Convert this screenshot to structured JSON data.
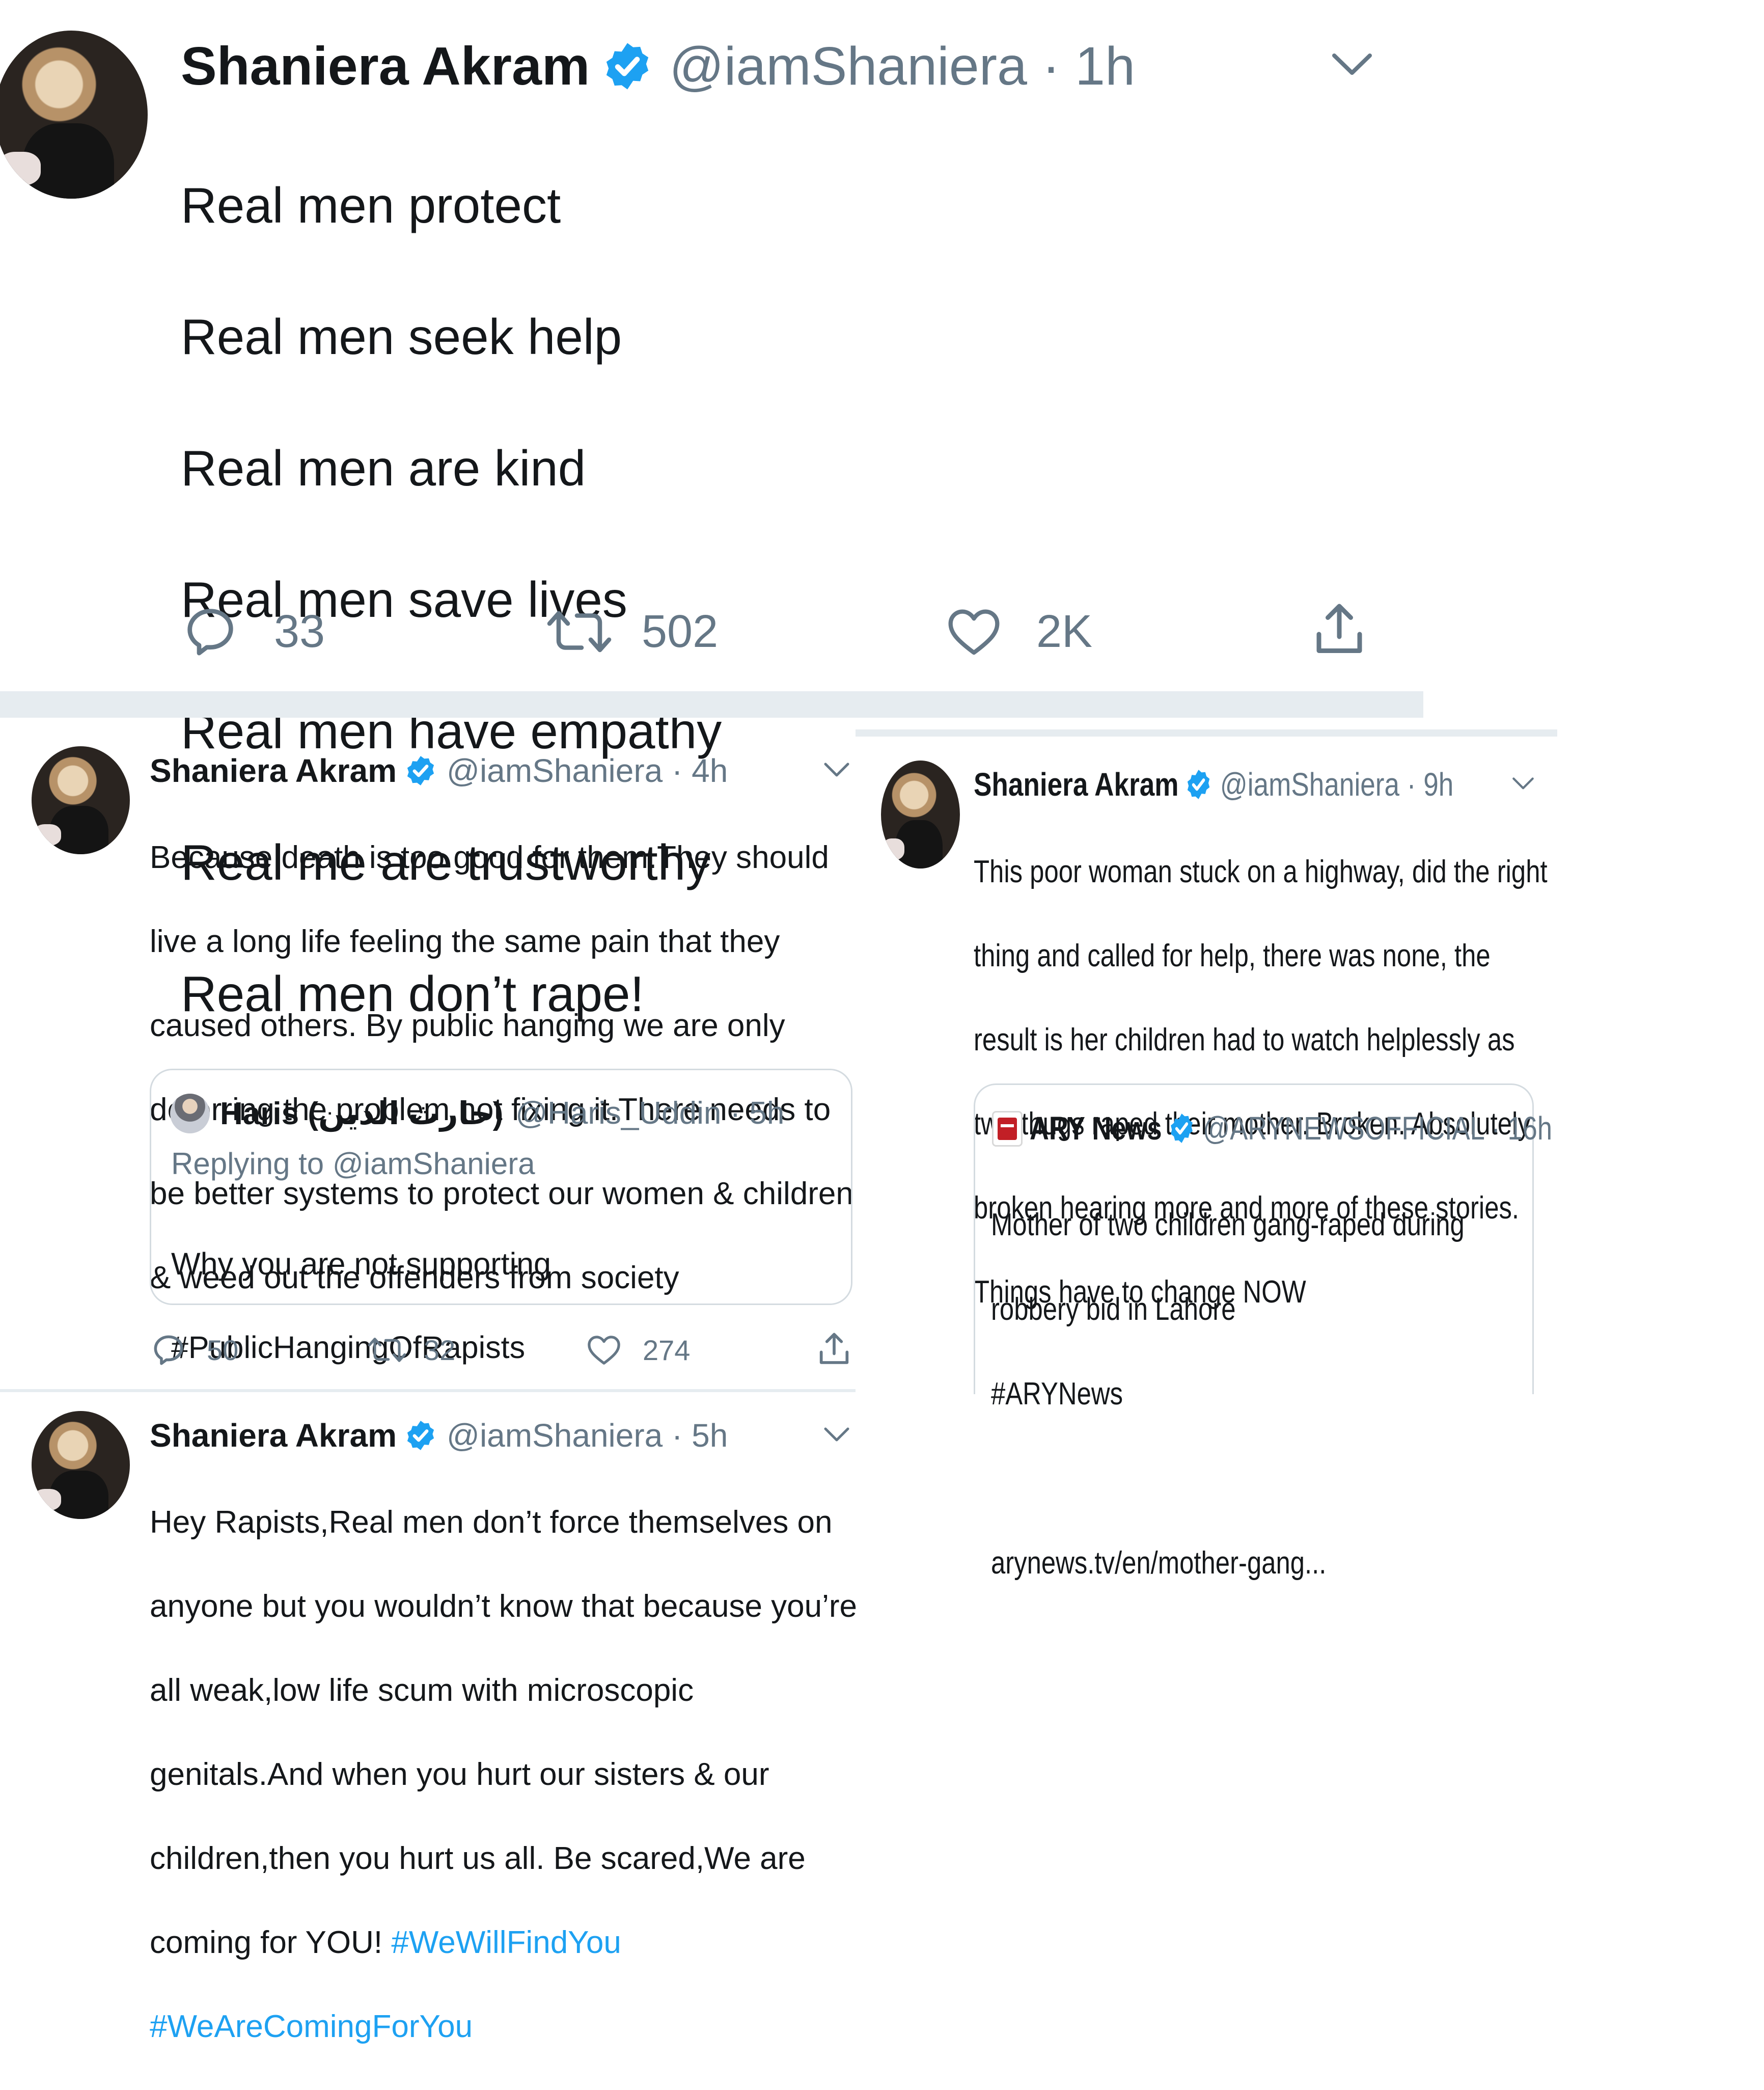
{
  "tweet_main": {
    "name": "Shaniera Akram",
    "handle": "@iamShaniera · 1h",
    "lines": [
      "Real men protect",
      "Real men seek help",
      "Real men are kind",
      "Real men save lives",
      "Real men have empathy",
      "Real me are trustworthy",
      "Real men don’t rape!"
    ],
    "replies": "33",
    "retweets": "502",
    "likes": "2K"
  },
  "tweet_left_1": {
    "name": "Shaniera Akram",
    "handle": "@iamShaniera · 4h",
    "lines": [
      "Because death is too good for them.They should",
      "live a long life feeling the same pain that they",
      "caused others. By public hanging we are only",
      "deterring the problem not fixing it.There needs to",
      "be better systems to protect our women & children",
      "& weed out the offenders from society"
    ],
    "quote": {
      "name": "Haris (حارث الدين)",
      "handle": "@Haris_Uddin · 5h",
      "replying_to": "Replying to @iamShaniera",
      "lines": [
        "Why you are not supporting",
        "#PublicHangingOfRapists"
      ]
    },
    "replies": "50",
    "retweets": "32",
    "likes": "274"
  },
  "tweet_left_2": {
    "name": "Shaniera Akram",
    "handle": "@iamShaniera · 5h",
    "lines": [
      "Hey Rapists,Real men don’t force themselves on",
      "anyone but you wouldn’t know that because you’re",
      "all weak,low life scum with microscopic",
      "genitals.And when you hurt our sisters & our",
      "children,then you hurt us all. Be scared,We are"
    ],
    "last_line_prefix": "coming for YOU! ",
    "hashtag_1": "#WeWillFindYou",
    "hashtag_2": "#WeAreComingForYou"
  },
  "tweet_right": {
    "name": "Shaniera Akram",
    "handle": "@iamShaniera · 9h",
    "lines": [
      "This poor woman stuck on a highway, did the right",
      "thing and called for help, there was none, the",
      "result is her children had to watch helplessly as",
      "two thugs raped their mother. Broken. Absolutely",
      "broken hearing more and more of these stories.",
      "Things have to change NOW"
    ],
    "quote": {
      "name": "ARY News",
      "handle": "@ARYNEWSOFFICIAL · 16h",
      "lines": [
        "Mother of two children gang-raped during",
        "robbery bid in Lahore",
        "#ARYNews",
        "",
        "arynews.tv/en/mother-gang..."
      ]
    }
  },
  "colors": {
    "text": "#14171a",
    "secondary": "#657786",
    "verified": "#1da1f2",
    "hashtag": "#1da1f2",
    "divider": "#e6ecf0"
  }
}
